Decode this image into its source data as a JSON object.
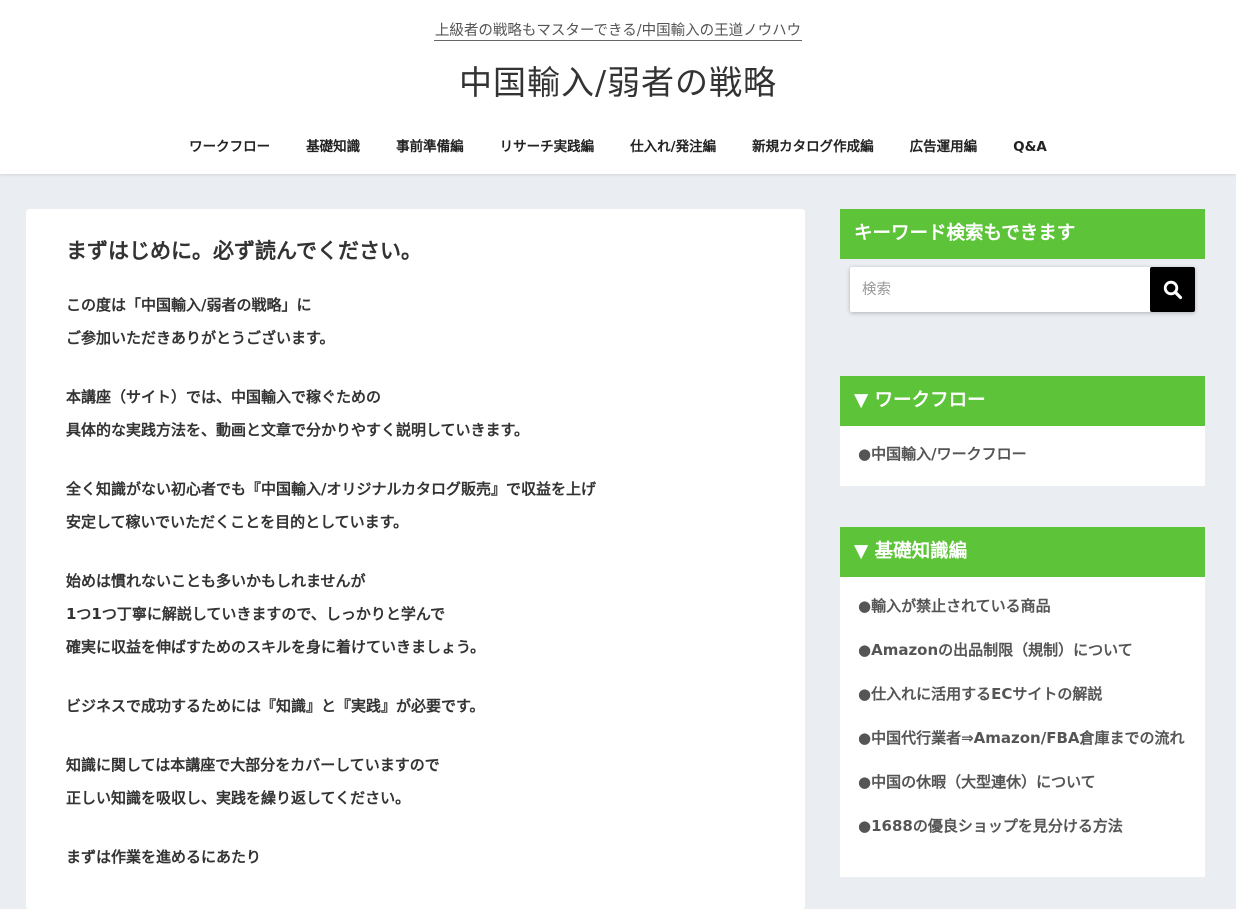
{
  "header": {
    "tagline": "上級者の戦略もマスターできる/中国輸入の王道ノウハウ",
    "site_title": "中国輸入/弱者の戦略",
    "nav": [
      "ワークフロー",
      "基礎知識",
      "事前準備編",
      "リサーチ実践編",
      "仕入れ/発注編",
      "新規カタログ作成編",
      "広告運用編",
      "Q&A"
    ]
  },
  "article": {
    "title": "まずはじめに。必ず読んでください。",
    "paragraphs": [
      [
        "この度は「中国輸入/弱者の戦略」に",
        "ご参加いただきありがとうございます。"
      ],
      [
        "本講座（サイト）では、中国輸入で稼ぐための",
        "具体的な実践方法を、動画と文章で分かりやすく説明していきます。"
      ],
      [
        "全く知識がない初心者でも『中国輸入/オリジナルカタログ販売』で収益を上げ",
        "安定して稼いでいただくことを目的としています。"
      ],
      [
        "始めは慣れないことも多いかもしれませんが",
        "1つ1つ丁寧に解説していきますので、しっかりと学んで",
        "確実に収益を伸ばすためのスキルを身に着けていきましょう。"
      ],
      [
        "ビジネスで成功するためには『知識』と『実践』が必要です。"
      ],
      [
        "知識に関しては本講座で大部分をカバーしていますので",
        "正しい知識を吸収し、実践を繰り返してください。"
      ],
      [
        "まずは作業を進めるにあたり"
      ]
    ]
  },
  "sidebar": {
    "search_title": "キーワード検索もできます",
    "search_placeholder": "検索",
    "search_icon": "search-icon",
    "workflow": {
      "title": "▼ ワークフロー",
      "links": [
        "●中国輸入/ワークフロー"
      ]
    },
    "basics": {
      "title": "▼ 基礎知識編",
      "links": [
        "●輸入が禁止されている商品",
        "●Amazonの出品制限（規制）について",
        "●仕入れに活用するECサイトの解説",
        "●中国代行業者⇒Amazon/FBA倉庫までの流れ",
        "●中国の休暇（大型連休）について",
        "●1688の優良ショップを見分ける方法"
      ]
    }
  },
  "colors": {
    "accent_green": "#5dc43a",
    "page_bg": "#eaedf2",
    "search_button": "#000000"
  }
}
